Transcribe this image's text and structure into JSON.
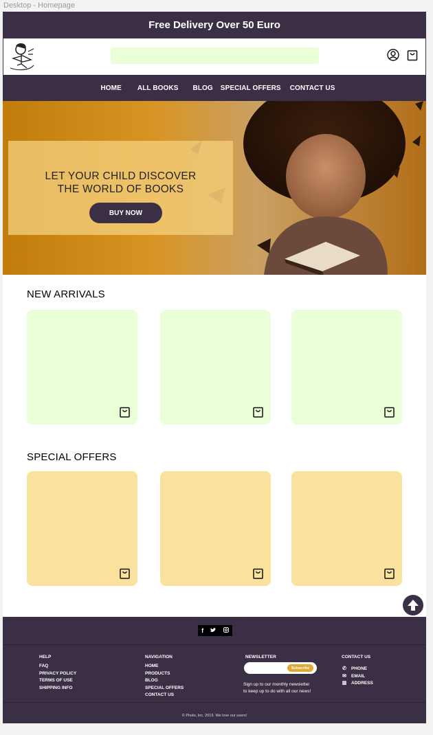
{
  "frame_label": "Desktop - Homepage",
  "promo_bar": "Free Delivery Over 50 Euro",
  "header": {
    "search_placeholder": "",
    "icons": [
      "user-icon",
      "cart-icon"
    ]
  },
  "nav": [
    "HOME",
    "ALL BOOKS",
    "BLOG",
    "SPECIAL OFFERS",
    "CONTACT US"
  ],
  "hero": {
    "line1": "LET YOUR CHILD DISCOVER",
    "line2": "THE WORLD OF BOOKS",
    "button": "BUY NOW"
  },
  "new_arrivals": {
    "title": "NEW ARRIVALS",
    "cards": 3
  },
  "special_offers": {
    "title": "SPECIAL OFFERS",
    "cards": 3
  },
  "footer": {
    "social": [
      "f",
      "t",
      "o"
    ],
    "help": {
      "title": "HELP",
      "links": [
        "FAQ",
        "PRIVACY POLICY",
        "TERMS OF USE",
        "SHIPPING INFO"
      ]
    },
    "navigation": {
      "title": "NAVIGATION",
      "links": [
        "HOME",
        "PRODUCTS",
        "BLOG",
        "SPECIAL OFFERS",
        "CONTACT US"
      ]
    },
    "newsletter": {
      "title": "NEWSLETTER",
      "button": "Subscribe",
      "text_line1": "Sign up to our monthly newsletter",
      "text_line2": "to keep up to do with all our news!"
    },
    "contact": {
      "title": "CONTACT US",
      "items": [
        "PHONE",
        "EMAIL",
        "ADDRESS"
      ]
    },
    "copyright": "© Photo, Inc. 2019. We love our users!"
  },
  "colors": {
    "dark_purple": "#3b2f45",
    "card_green": "#eaffd8",
    "card_yellow": "#fae29e",
    "accent_orange": "#e0a836"
  }
}
